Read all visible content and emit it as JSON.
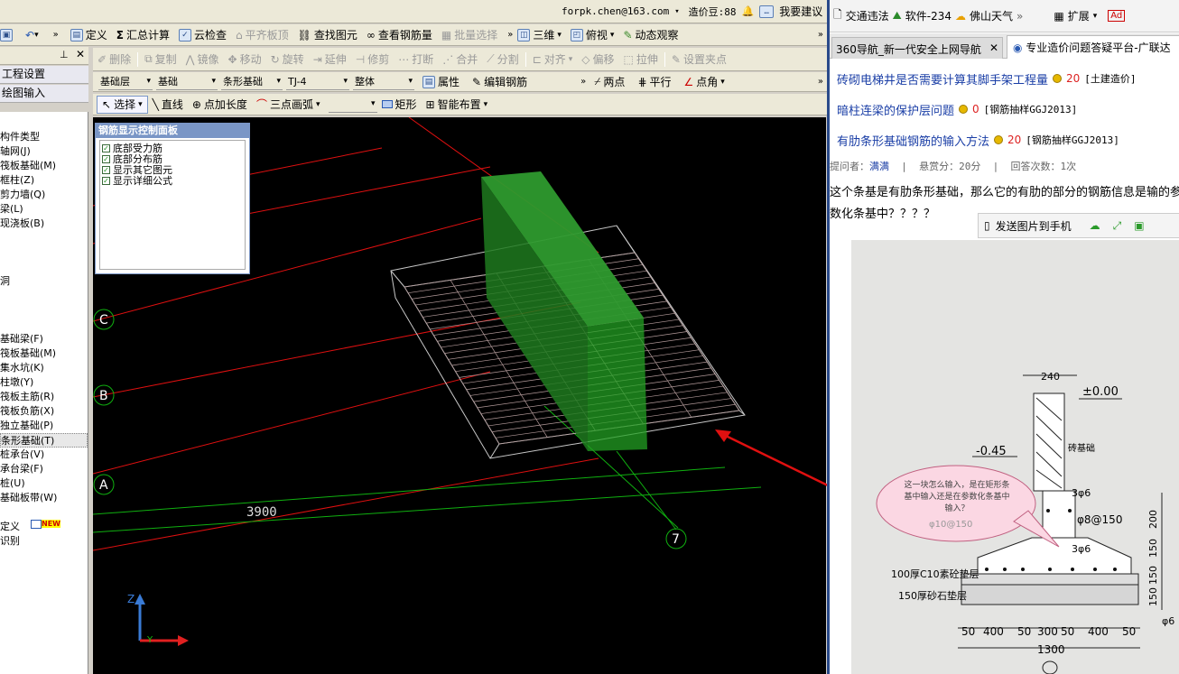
{
  "topbar": {
    "email": "forpk.chen@163.com",
    "coin": "造价豆:88",
    "suggest": "我要建议"
  },
  "menubar": {
    "items": [
      "定义",
      "汇总计算",
      "云检查",
      "平齐板顶",
      "查找图元",
      "查看钢筋量",
      "批量选择",
      "三维",
      "俯视",
      "动态观察"
    ]
  },
  "toolbar2": {
    "items": [
      "删除",
      "复制",
      "镜像",
      "移动",
      "旋转",
      "延伸",
      "修剪",
      "打断",
      "合并",
      "分割",
      "对齐",
      "偏移",
      "拉伸",
      "设置夹点"
    ]
  },
  "toolbar3": {
    "layer": "基础层",
    "category": "基础",
    "type": "条形基础",
    "name": "TJ-4",
    "whole": "整体",
    "attr": "属性",
    "edit": "编辑钢筋",
    "two_points": "两点",
    "parallel": "平行",
    "angle": "点角"
  },
  "toolbar4": {
    "select": "选择",
    "line": "直线",
    "point_len": "点加长度",
    "arc": "三点画弧",
    "rect": "矩形",
    "smart": "智能布置"
  },
  "left_tabs": {
    "project": "工程设置",
    "draw": "绘图输入"
  },
  "left_items": [
    "构件类型",
    "轴网(J)",
    "筏板基础(M)",
    "框柱(Z)",
    "剪力墙(Q)",
    "梁(L)",
    "现浇板(B)",
    "",
    "",
    "",
    "洞",
    "",
    "",
    "",
    "基础梁(F)",
    "筏板基础(M)",
    "集水坑(K)",
    "柱墩(Y)",
    "筏板主筋(R)",
    "筏板负筋(X)",
    "独立基础(P)",
    "条形基础(T)",
    "桩承台(V)",
    "承台梁(F)",
    "桩(U)",
    "基础板带(W)",
    "",
    "定义",
    "识别"
  ],
  "left_new": "NEW",
  "rebar_panel": {
    "title": "钢筋显示控制面板",
    "options": [
      "底部受力筋",
      "底部分布筋",
      "显示其它图元",
      "显示详细公式"
    ]
  },
  "viewport": {
    "axis_labels": [
      "C",
      "B",
      "A",
      "7"
    ],
    "dimension": "3900",
    "axis_z": "Z",
    "axis_y": "Y",
    "axis_x": "X"
  },
  "browser": {
    "bookmarks": [
      "交通违法",
      "软件-234",
      "佛山天气",
      "扩展",
      "Ad"
    ],
    "tabs": [
      "360导航_新一代安全上网导航",
      "专业造价问题答疑平台-广联达"
    ],
    "links": [
      {
        "title": "砖砌电梯井是否需要计算其脚手架工程量",
        "score": "20",
        "tag": "[土建造价]"
      },
      {
        "title": "暗柱连梁的保护层问题",
        "score": "0",
        "tag": "[钢筋抽样GGJ2013]"
      },
      {
        "title": "有肋条形基础钢筋的输入方法",
        "score": "20",
        "tag": "[钢筋抽样GGJ2013]"
      }
    ],
    "meta": {
      "asker_label": "提问者：",
      "asker": "满满",
      "reward": "悬赏分：20分",
      "answers": "回答次数：1次"
    },
    "question": "这个条基是有肋条形基础，那么它的有肋的部分的钢筋信息是输的参数化条基中？？？？",
    "send_phone": "发送图片到手机",
    "drawing": {
      "elev0": "±0.00",
      "width240": "240",
      "elev045": "-0.45",
      "brick": "砖基础",
      "bubble": "这一块怎么输入，是在矩形条基中输入还是在参数化条基中输入？",
      "r1": "3φ6",
      "r2": "φ8@150",
      "r3": "3φ6",
      "r4": "φ10@150",
      "pad": "100厚C10素砼垫层",
      "sand": "150厚砂石垫层",
      "dims_bottom": [
        "50",
        "400",
        "50",
        "300",
        "50",
        "400",
        "50"
      ],
      "total": "1300",
      "dims_right": [
        "200",
        "150",
        "150",
        "150"
      ],
      "phi6": "φ6"
    }
  }
}
